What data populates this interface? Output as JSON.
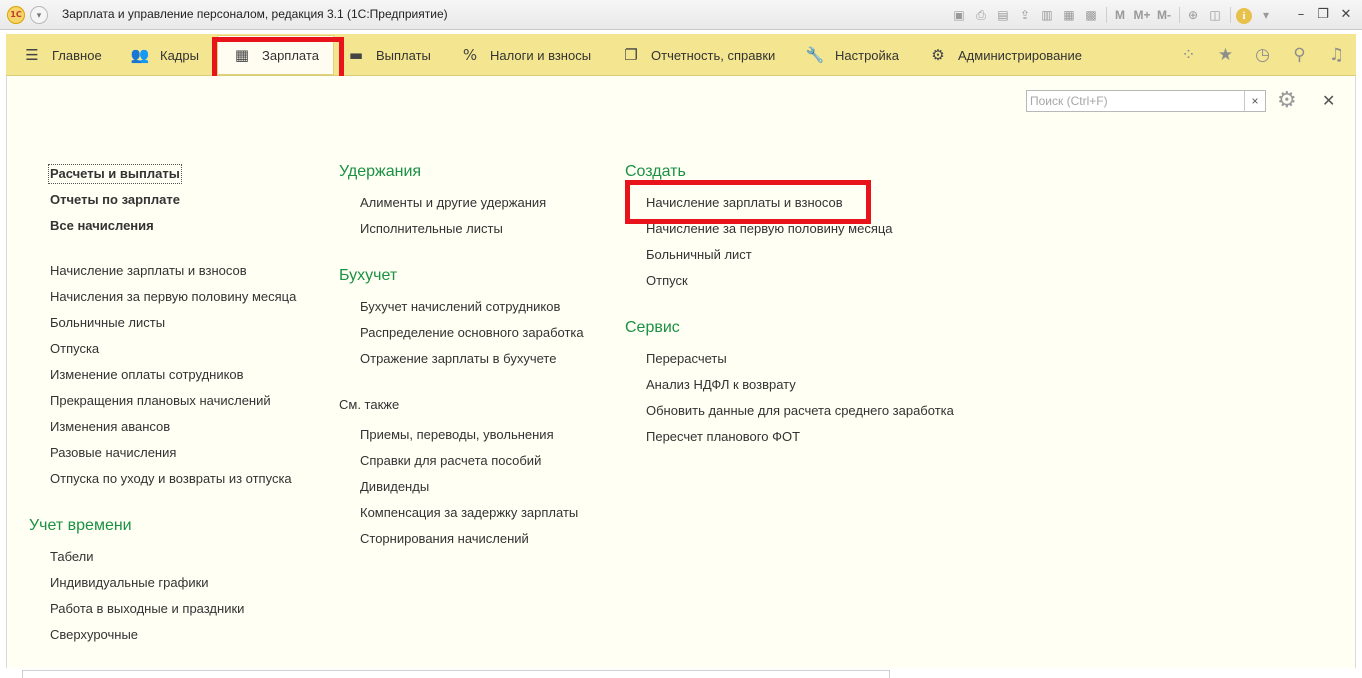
{
  "window": {
    "title": "Зарплата и управление персоналом, редакция 3.1  (1С:Предприятие)",
    "logo_text": "1С",
    "tools": [
      "M",
      "M+",
      "M-"
    ]
  },
  "nav": {
    "items": [
      {
        "label": "Главное",
        "icon": "menu-icon",
        "glyph": "☰"
      },
      {
        "label": "Кадры",
        "icon": "people-icon",
        "glyph": "👥"
      },
      {
        "label": "Зарплата",
        "icon": "calculator-icon",
        "glyph": "▦"
      },
      {
        "label": "Выплаты",
        "icon": "wallet-icon",
        "glyph": "▬"
      },
      {
        "label": "Налоги и взносы",
        "icon": "percent-icon",
        "glyph": "%"
      },
      {
        "label": "Отчетность, справки",
        "icon": "documents-icon",
        "glyph": "❐"
      },
      {
        "label": "Настройка",
        "icon": "wrench-icon",
        "glyph": "🔧"
      },
      {
        "label": "Администрирование",
        "icon": "gear-icon",
        "glyph": "⚙"
      }
    ],
    "active": "Зарплата"
  },
  "search": {
    "placeholder": "Поиск (Ctrl+F)",
    "clear": "×"
  },
  "col1": {
    "links_bold": [
      "Расчеты и выплаты",
      "Отчеты по зарплате",
      "Все начисления"
    ],
    "links": [
      "Начисление зарплаты и взносов",
      "Начисления за первую половину месяца",
      "Больничные листы",
      "Отпуска",
      "Изменение оплаты сотрудников",
      "Прекращения плановых начислений",
      "Изменения авансов",
      "Разовые начисления",
      "Отпуска по уходу и возвраты из отпуска"
    ],
    "time_section": "Учет времени",
    "time_links": [
      "Табели",
      "Индивидуальные графики",
      "Работа в выходные и праздники",
      "Сверхурочные"
    ]
  },
  "col2": {
    "deductions_section": "Удержания",
    "deductions_links": [
      "Алименты и другие удержания",
      "Исполнительные листы"
    ],
    "accounting_section": "Бухучет",
    "accounting_links": [
      "Бухучет начислений сотрудников",
      "Распределение основного заработка",
      "Отражение зарплаты в бухучете"
    ],
    "see_also": "См. также",
    "see_also_links": [
      "Приемы, переводы, увольнения",
      "Справки для расчета пособий",
      "Дивиденды",
      "Компенсация за задержку зарплаты",
      "Сторнирования начислений"
    ]
  },
  "col3": {
    "create_section": "Создать",
    "create_links": [
      "Начисление зарплаты и взносов",
      "Начисление за первую половину месяца",
      "Больничный лист",
      "Отпуск"
    ],
    "service_section": "Сервис",
    "service_links": [
      "Перерасчеты",
      "Анализ НДФЛ к возврату",
      "Обновить данные для расчета среднего заработка",
      "Пересчет планового ФОТ"
    ]
  },
  "colors": {
    "navbar": "#f4e690",
    "content_bg": "#fffff4",
    "section": "#1a9143",
    "highlight": "#e8131b"
  }
}
